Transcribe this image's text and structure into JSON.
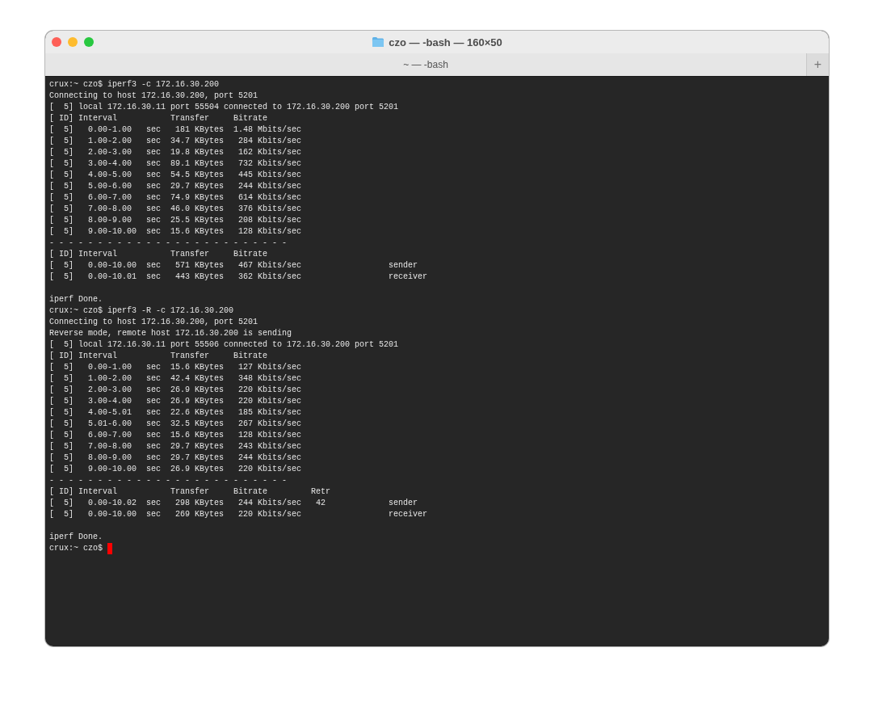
{
  "window": {
    "title": "czo — -bash — 160×50"
  },
  "tabs": [
    {
      "label": "~ — -bash",
      "selected": true
    }
  ],
  "new_tab_button": {
    "label": "+"
  },
  "terminal": {
    "blocks": [
      [
        "crux:~ czo$ iperf3 -c 172.16.30.200",
        "Connecting to host 172.16.30.200, port 5201",
        "[  5] local 172.16.30.11 port 55504 connected to 172.16.30.200 port 5201",
        "[ ID] Interval           Transfer     Bitrate",
        "[  5]   0.00-1.00   sec   181 KBytes  1.48 Mbits/sec",
        "[  5]   1.00-2.00   sec  34.7 KBytes   284 Kbits/sec",
        "[  5]   2.00-3.00   sec  19.8 KBytes   162 Kbits/sec",
        "[  5]   3.00-4.00   sec  89.1 KBytes   732 Kbits/sec",
        "[  5]   4.00-5.00   sec  54.5 KBytes   445 Kbits/sec",
        "[  5]   5.00-6.00   sec  29.7 KBytes   244 Kbits/sec",
        "[  5]   6.00-7.00   sec  74.9 KBytes   614 Kbits/sec",
        "[  5]   7.00-8.00   sec  46.0 KBytes   376 Kbits/sec",
        "[  5]   8.00-9.00   sec  25.5 KBytes   208 Kbits/sec",
        "[  5]   9.00-10.00  sec  15.6 KBytes   128 Kbits/sec",
        "- - - - - - - - - - - - - - - - - - - - - - - - -",
        "[ ID] Interval           Transfer     Bitrate",
        "[  5]   0.00-10.00  sec   571 KBytes   467 Kbits/sec                  sender",
        "[  5]   0.00-10.01  sec   443 KBytes   362 Kbits/sec                  receiver"
      ],
      [
        "iperf Done.",
        "crux:~ czo$ iperf3 -R -c 172.16.30.200",
        "Connecting to host 172.16.30.200, port 5201",
        "Reverse mode, remote host 172.16.30.200 is sending",
        "[  5] local 172.16.30.11 port 55506 connected to 172.16.30.200 port 5201",
        "[ ID] Interval           Transfer     Bitrate",
        "[  5]   0.00-1.00   sec  15.6 KBytes   127 Kbits/sec",
        "[  5]   1.00-2.00   sec  42.4 KBytes   348 Kbits/sec",
        "[  5]   2.00-3.00   sec  26.9 KBytes   220 Kbits/sec",
        "[  5]   3.00-4.00   sec  26.9 KBytes   220 Kbits/sec",
        "[  5]   4.00-5.01   sec  22.6 KBytes   185 Kbits/sec",
        "[  5]   5.01-6.00   sec  32.5 KBytes   267 Kbits/sec",
        "[  5]   6.00-7.00   sec  15.6 KBytes   128 Kbits/sec",
        "[  5]   7.00-8.00   sec  29.7 KBytes   243 Kbits/sec",
        "[  5]   8.00-9.00   sec  29.7 KBytes   244 Kbits/sec",
        "[  5]   9.00-10.00  sec  26.9 KBytes   220 Kbits/sec",
        "- - - - - - - - - - - - - - - - - - - - - - - - -",
        "[ ID] Interval           Transfer     Bitrate         Retr",
        "[  5]   0.00-10.02  sec   298 KBytes   244 Kbits/sec   42             sender",
        "[  5]   0.00-10.00  sec   269 KBytes   220 Kbits/sec                  receiver"
      ],
      [
        "iperf Done."
      ]
    ],
    "prompt": "crux:~ czo$ "
  }
}
